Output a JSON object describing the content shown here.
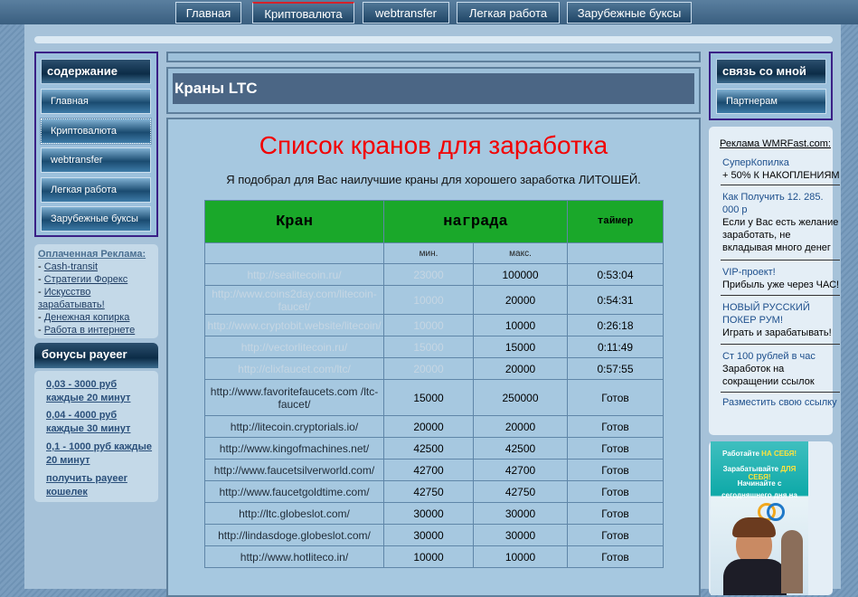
{
  "topnav": {
    "tabs": [
      {
        "label": "Главная",
        "active": false
      },
      {
        "label": "Криптовалюта",
        "active": true
      },
      {
        "label": "webtransfer",
        "active": false
      },
      {
        "label": "Легкая работа",
        "active": false
      },
      {
        "label": "Зарубежные буксы",
        "active": false
      }
    ]
  },
  "left": {
    "contents_title": "содержание",
    "nav": [
      "Главная",
      "Криптовалюта",
      "webtransfer",
      "Легкая работа",
      "Зарубежные буксы"
    ],
    "ads": {
      "title": "Оплаченная Реклама:",
      "links": [
        "Cash-transit",
        "Стратегии Форекс",
        "Искусство зарабатывать!",
        "Денежная копирка",
        "Работа в интернете"
      ]
    },
    "bonus": {
      "title": "бонусы payeer",
      "links": [
        "0,03 - 3000 руб каждые 20 минут",
        "0,04 - 4000 руб каждые 30 минут",
        "0,1 - 1000 руб каждые 20 минут",
        "получить payeer кошелек"
      ]
    }
  },
  "center": {
    "title": "Краны LTC",
    "heading": "Список кранов для заработка",
    "intro": "Я подобрал для Вас наилучшие краны для хорошего заработка ЛИТОШЕЙ.",
    "table": {
      "col_faucet": "Кран",
      "col_reward": "награда",
      "col_timer": "таймер",
      "sub_min": "мин.",
      "sub_max": "макс.",
      "rows": [
        {
          "site": "http://sealitecoin.ru/",
          "min": "23000",
          "max": "100000",
          "timer": "0:53:04",
          "dim": true
        },
        {
          "site": "http://www.coins2day.com/litecoin-faucet/",
          "min": "10000",
          "max": "20000",
          "timer": "0:54:31",
          "dim": true
        },
        {
          "site": "http://www.cryptobit.website/litecoin/",
          "min": "10000",
          "max": "10000",
          "timer": "0:26:18",
          "dim": true
        },
        {
          "site": "http://vectorlitecoin.ru/",
          "min": "15000",
          "max": "15000",
          "timer": "0:11:49",
          "dim": true
        },
        {
          "site": "http://clixfaucet.com/ltc/",
          "min": "20000",
          "max": "20000",
          "timer": "0:57:55",
          "dim": true
        },
        {
          "site": "http://www.favoritefaucets.com /ltc-faucet/",
          "min": "15000",
          "max": "250000",
          "timer": "Готов",
          "dim": false
        },
        {
          "site": "http://litecoin.cryptorials.io/",
          "min": "20000",
          "max": "20000",
          "timer": "Готов",
          "dim": false
        },
        {
          "site": "http://www.kingofmachines.net/",
          "min": "42500",
          "max": "42500",
          "timer": "Готов",
          "dim": false
        },
        {
          "site": "http://www.faucetsilverworld.com/",
          "min": "42700",
          "max": "42700",
          "timer": "Готов",
          "dim": false
        },
        {
          "site": "http://www.faucetgoldtime.com/",
          "min": "42750",
          "max": "42750",
          "timer": "Готов",
          "dim": false
        },
        {
          "site": "http://ltc.globeslot.com/",
          "min": "30000",
          "max": "30000",
          "timer": "Готов",
          "dim": false
        },
        {
          "site": "http://lindasdoge.globeslot.com/",
          "min": "30000",
          "max": "30000",
          "timer": "Готов",
          "dim": false
        },
        {
          "site": "http://www.hotliteco.in/",
          "min": "10000",
          "max": "10000",
          "timer": "Готов",
          "dim": false
        }
      ]
    }
  },
  "right": {
    "contact_title": "связь со мной",
    "partners": "Партнерам",
    "ad_header": "Реклама WMRFast.com:",
    "ads": [
      {
        "title": "СуперКопилка",
        "desc": "+ 50% К НАКОПЛЕНИЯМ"
      },
      {
        "title": "Как Получить 12. 285. 000 р",
        "desc": "Если у Вас есть желание заработать, не вкладывая много денег"
      },
      {
        "title": "VIP-проект!",
        "desc": "Прибыль уже через ЧАС!"
      },
      {
        "title": "НОВЫЙ РУССКИЙ ПОКЕР РУМ!",
        "desc": "Играть и зарабатывать!"
      },
      {
        "title": "Ст 100 рублей в час",
        "desc": "Заработок на сокращении ссылок"
      }
    ],
    "place_ad": "Разместить свою ссылку",
    "banner": {
      "line1a": "Работайте",
      "line1b": "НА СЕБЯ!",
      "line2a": "Зарабатывайте",
      "line2b": "ДЛЯ СЕБЯ!",
      "line3": "Начинайте с",
      "line4": "сегодняшнего дня на"
    }
  }
}
